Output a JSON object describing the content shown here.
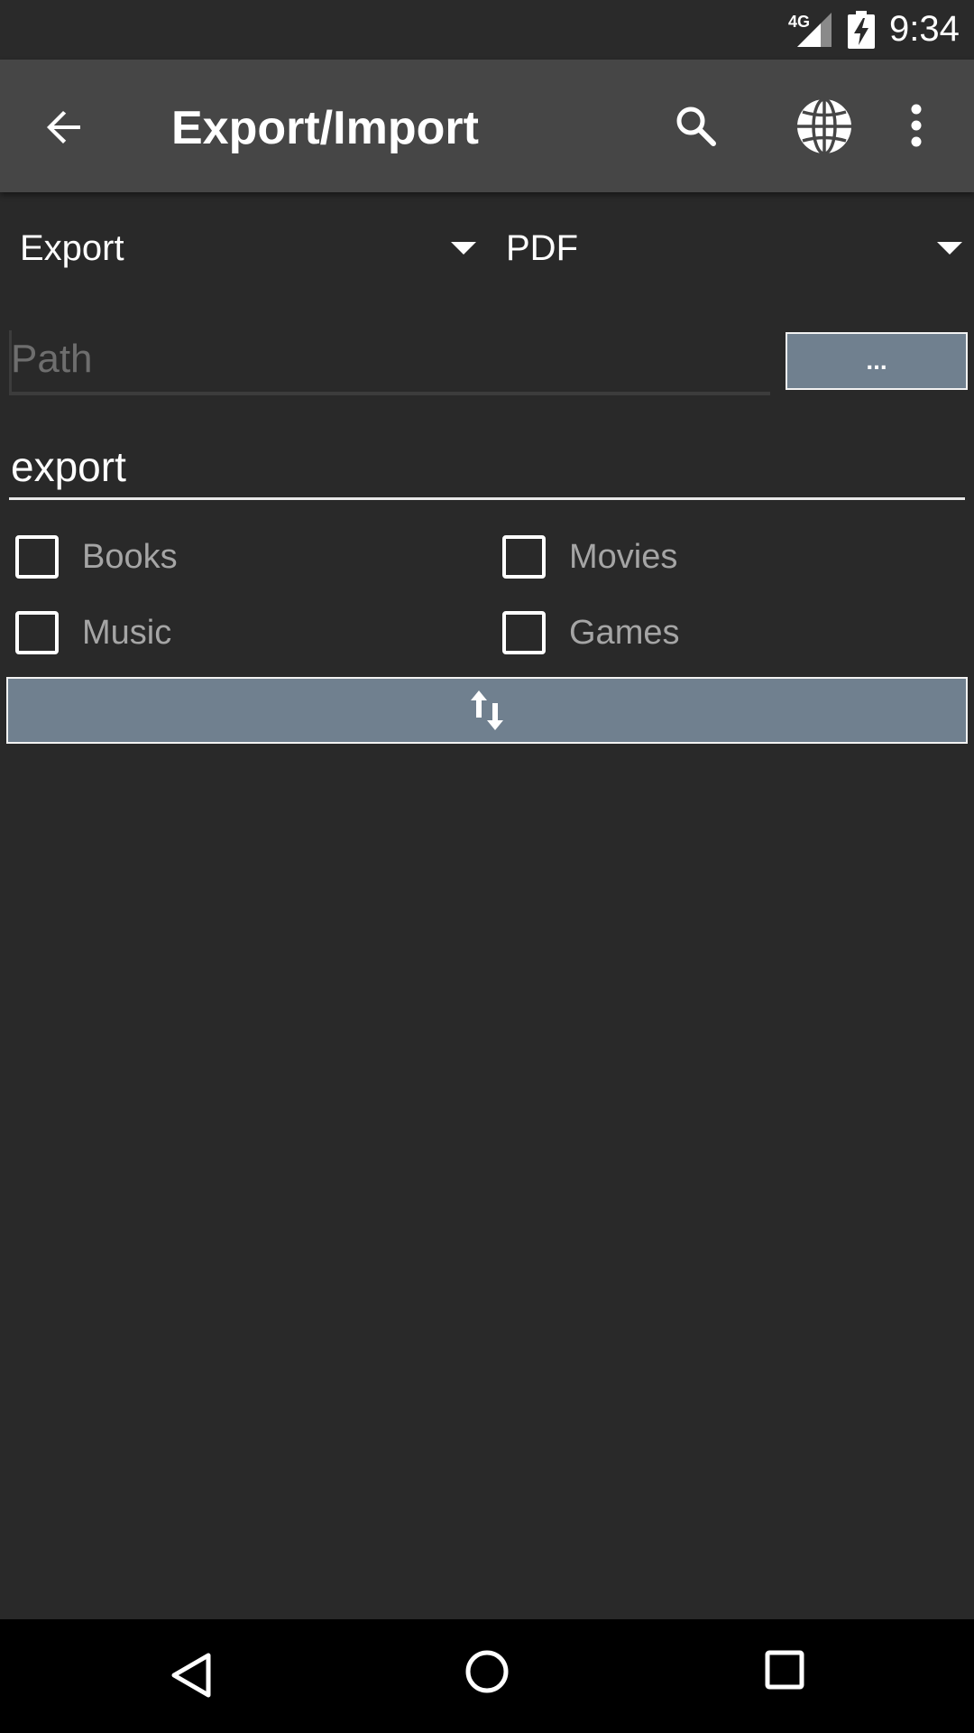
{
  "status_bar": {
    "network": "4G",
    "time": "9:34",
    "icons": [
      "signal-icon",
      "battery-charging-icon"
    ]
  },
  "app_bar": {
    "title": "Export/Import",
    "icons": [
      "back-arrow-icon",
      "search-icon",
      "globe-icon",
      "more-vert-icon"
    ]
  },
  "form": {
    "mode_spinner": {
      "selected": "Export"
    },
    "format_spinner": {
      "selected": "PDF"
    },
    "path": {
      "placeholder": "Path",
      "value": ""
    },
    "browse_button": {
      "label": "..."
    },
    "filename": {
      "value": "export"
    },
    "checkboxes": [
      {
        "label": "Books",
        "checked": false
      },
      {
        "label": "Movies",
        "checked": false
      },
      {
        "label": "Music",
        "checked": false
      },
      {
        "label": "Games",
        "checked": false
      }
    ],
    "action_button": {
      "icon": "swap-vert-icon"
    }
  },
  "nav_bar": {
    "icons": [
      "nav-back-icon",
      "nav-home-icon",
      "nav-recent-icon"
    ]
  },
  "colors": {
    "background": "#292929",
    "app_bar": "#464646",
    "button": "#70808f",
    "checkbox_label": "#a5a5a5"
  }
}
